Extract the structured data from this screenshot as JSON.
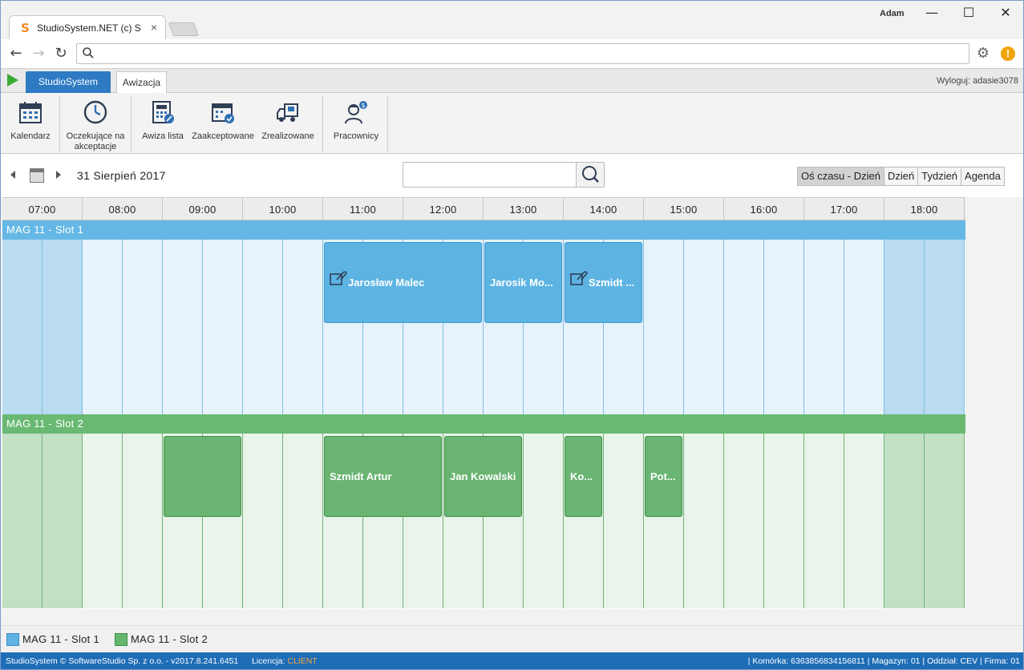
{
  "browser": {
    "tab_title": "StudioSystem.NET (c) Sof",
    "tab_close": "×",
    "user": "Adam",
    "minimize": "—",
    "maximize": "☐",
    "close": "✕",
    "address_value": "",
    "favicon_letter": "S"
  },
  "app": {
    "primary_tab": "StudioSystem",
    "active_tab": "Awizacja",
    "logout": "Wyloguj: adasie3078"
  },
  "ribbon": [
    {
      "label": "Kalendarz",
      "icon": "calendar-icon"
    },
    {
      "label": "Oczekujące na akceptacje",
      "icon": "clock-icon"
    },
    {
      "label": "Awiza lista",
      "icon": "calculator-edit-icon"
    },
    {
      "label": "Zaakceptowane",
      "icon": "calendar-check-icon"
    },
    {
      "label": "Zrealizowane",
      "icon": "truck-icon"
    },
    {
      "label": "Pracownicy",
      "icon": "worker-money-icon"
    }
  ],
  "toolbar": {
    "date": "31 Sierpień 2017",
    "search_value": "",
    "views": [
      "Oś czasu - Dzień",
      "Dzień",
      "Tydzień",
      "Agenda"
    ],
    "active_view": "Oś czasu - Dzień"
  },
  "timeline": {
    "hours": [
      "07:00",
      "08:00",
      "09:00",
      "10:00",
      "11:00",
      "12:00",
      "13:00",
      "14:00",
      "15:00",
      "16:00",
      "17:00",
      "18:00"
    ],
    "rows": [
      {
        "name": "MAG 11 - Slot 1",
        "color": "#5fb3e3",
        "events": [
          {
            "title": "Jarosław Malec",
            "start": "11:00",
            "end": "13:00",
            "attachment": true
          },
          {
            "title": "Jarosik Mo...",
            "start": "13:00",
            "end": "14:00",
            "attachment": false
          },
          {
            "title": "Szmidt ...",
            "start": "14:00",
            "end": "15:00",
            "attachment": true
          }
        ]
      },
      {
        "name": "MAG 11 - Slot 2",
        "color": "#66b56f",
        "events": [
          {
            "title": "",
            "start": "09:00",
            "end": "10:00",
            "attachment": false
          },
          {
            "title": "Szmidt Artur",
            "start": "11:00",
            "end": "12:30",
            "attachment": false
          },
          {
            "title": "Jan Kowalski",
            "start": "12:30",
            "end": "13:30",
            "attachment": false
          },
          {
            "title": "Ko...",
            "start": "14:00",
            "end": "14:30",
            "attachment": false
          },
          {
            "title": "Pot...",
            "start": "15:00",
            "end": "15:30",
            "attachment": false
          }
        ]
      }
    ]
  },
  "legend": [
    "MAG 11 - Slot 1",
    "MAG 11 - Slot 2"
  ],
  "status": {
    "left": "StudioSystem © SoftwareStudio Sp. z o.o. - v2017.8.241.6451",
    "license_label": "Licencja:",
    "license_value": "CLIENT",
    "right": "| Komórka: 6363856834156811 | Magazyn: 01 | Oddział: CEV | Firma: 01"
  }
}
